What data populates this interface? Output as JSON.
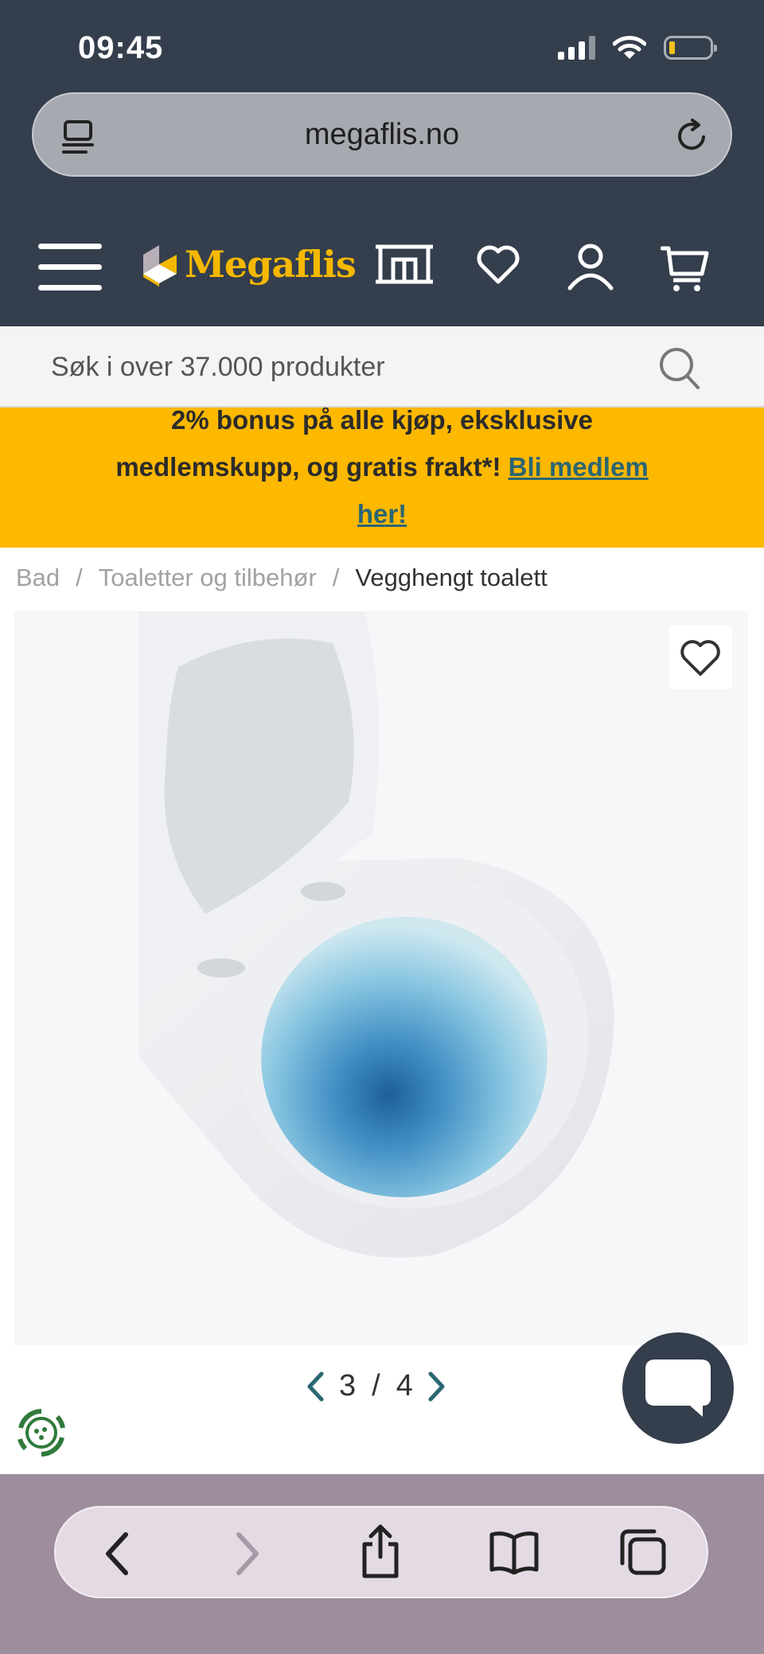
{
  "status_bar": {
    "time": "09:45"
  },
  "browser": {
    "url": "megaflis.no"
  },
  "site": {
    "logo_text": "Megaflis",
    "search_placeholder": "Søk i over 37.000 produkter"
  },
  "promo": {
    "line1": "2% bonus på alle kjøp, eksklusive",
    "line2_text": "medlemskupp, og gratis frakt*! ",
    "link_text_part1": "Bli medlem",
    "link_text_part2": "her!"
  },
  "breadcrumb": {
    "items": [
      "Bad",
      "Toaletter og tilbehør"
    ],
    "separator": "/",
    "current": "Vegghengt toalett"
  },
  "gallery": {
    "current": "3",
    "separator": "/",
    "total": "4"
  },
  "colors": {
    "header_bg": "#343e4c",
    "promo_bg": "#fdb800",
    "brand_yellow": "#f5b800",
    "link_teal": "#2b6673",
    "bottom_bar_bg": "#9d8d9d"
  },
  "icons": {
    "url_bar": [
      "reader-icon",
      "reload-icon"
    ],
    "header": [
      "menu-icon",
      "store-icon",
      "heart-icon",
      "user-icon",
      "cart-icon"
    ],
    "toolbar": [
      "back-icon",
      "forward-icon",
      "share-icon",
      "bookmarks-icon",
      "tabs-icon"
    ]
  }
}
